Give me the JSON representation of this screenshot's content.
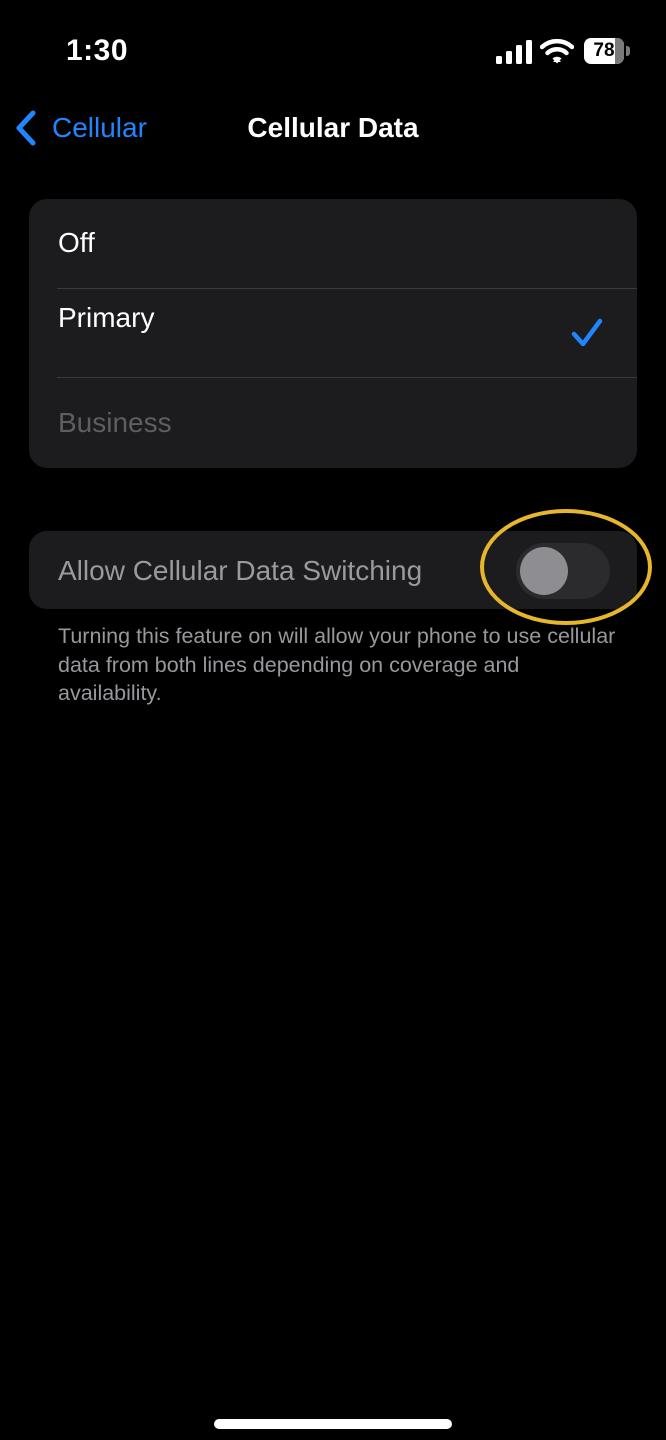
{
  "status_bar": {
    "time": "1:30",
    "battery_level": "78",
    "battery_fraction": 0.78,
    "icons": [
      "signal-icon",
      "wifi-icon",
      "battery-icon"
    ]
  },
  "nav": {
    "back_label": "Cellular",
    "back_icon": "chevron-left-icon",
    "title": "Cellular Data"
  },
  "lines": {
    "items": [
      {
        "label": "Off",
        "selected": false,
        "enabled": true
      },
      {
        "label": "Primary",
        "selected": true,
        "enabled": true
      },
      {
        "label": "Business",
        "selected": false,
        "enabled": false
      }
    ]
  },
  "switching": {
    "label": "Allow Cellular Data Switching",
    "enabled": false,
    "footnote": "Turning this feature on will allow your phone to use cellular data from both lines depending on coverage and availability."
  },
  "colors": {
    "accent": "#1f86ff",
    "background": "#000000",
    "group_background": "#1c1c1e",
    "annotation": "#e8b62a"
  }
}
